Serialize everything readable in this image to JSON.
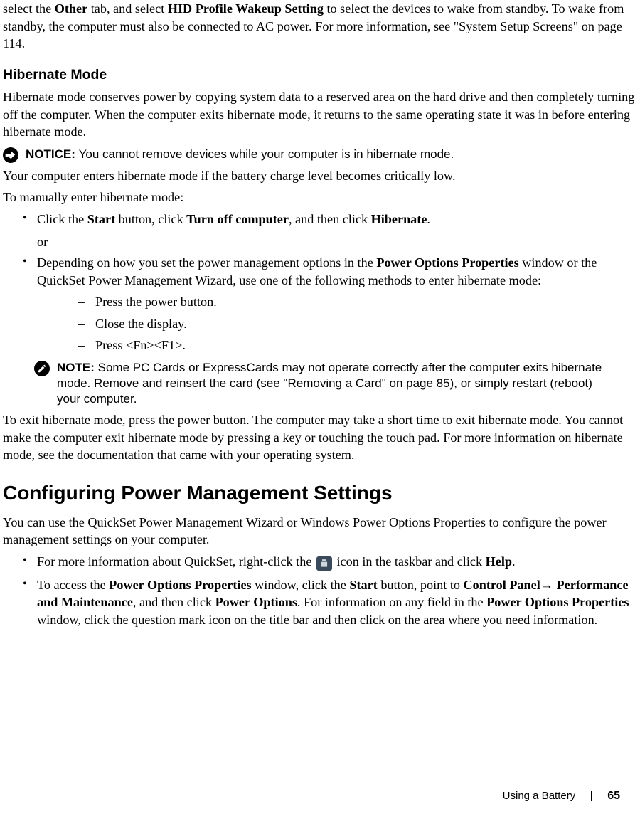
{
  "intro": {
    "part1": "select the ",
    "b1": "Other",
    "part2": " tab, and select ",
    "b2": "HID Profile Wakeup Setting",
    "part3": " to select the devices to wake from standby. To wake from standby, the computer must also be connected to AC power. For more information, see \"System Setup Screens\" on page 114."
  },
  "hibernate": {
    "heading": "Hibernate Mode",
    "p1": "Hibernate mode conserves power by copying system data to a reserved area on the hard drive and then completely turning off the computer. When the computer exits hibernate mode, it returns to the same operating state it was in before entering hibernate mode.",
    "notice_label": "NOTICE: ",
    "notice_text": "You cannot remove devices while your computer is in hibernate mode.",
    "p2": "Your computer enters hibernate mode if the battery charge level becomes critically low.",
    "p3": "To manually enter hibernate mode:",
    "li1_a": "Click the ",
    "li1_b1": "Start",
    "li1_b": " button, click ",
    "li1_b2": "Turn off computer",
    "li1_c": ", and then click ",
    "li1_b3": "Hibernate",
    "li1_d": ".",
    "or": "or",
    "li2_a": "Depending on how you set the power management options in the ",
    "li2_b1": "Power Options Properties",
    "li2_b": " window or the QuickSet Power Management Wizard, use one of the following methods to enter hibernate mode:",
    "d1": "Press the power button.",
    "d2": "Close the display.",
    "d3": "Press <Fn><F1>.",
    "note_label": "NOTE: ",
    "note_text": "Some PC Cards or ExpressCards may not operate correctly after the computer exits hibernate mode. Remove and reinsert the card (see \"Removing a Card\" on page 85), or simply restart (reboot) your computer.",
    "p4": "To exit hibernate mode, press the power button. The computer may take a short time to exit hibernate mode. You cannot make the computer exit hibernate mode by pressing a key or touching the touch pad. For more information on hibernate mode, see the documentation that came with your operating system."
  },
  "config": {
    "heading": "Configuring Power Management Settings",
    "p1": "You can use the QuickSet Power Management Wizard or Windows Power Options Properties to configure the power management settings on your computer.",
    "li1_a": "For more information about QuickSet, right-click the ",
    "li1_b": " icon in the taskbar and click ",
    "li1_b1": "Help",
    "li1_c": ".",
    "li2_a": "To access the ",
    "li2_b1": "Power Options Properties",
    "li2_b": " window, click the ",
    "li2_b2": "Start",
    "li2_c": " button, point to ",
    "li2_b3": "Control Panel",
    "li2_arrow": "→ ",
    "li2_b4": "Performance and Maintenance",
    "li2_d": ", and then click ",
    "li2_b5": "Power Options",
    "li2_e": ". For information on any field in the ",
    "li2_b6": "Power Options Properties",
    "li2_f": " window, click the question mark icon on the title bar and then click on the area where you need information."
  },
  "footer": {
    "section": "Using a Battery",
    "page": "65"
  }
}
